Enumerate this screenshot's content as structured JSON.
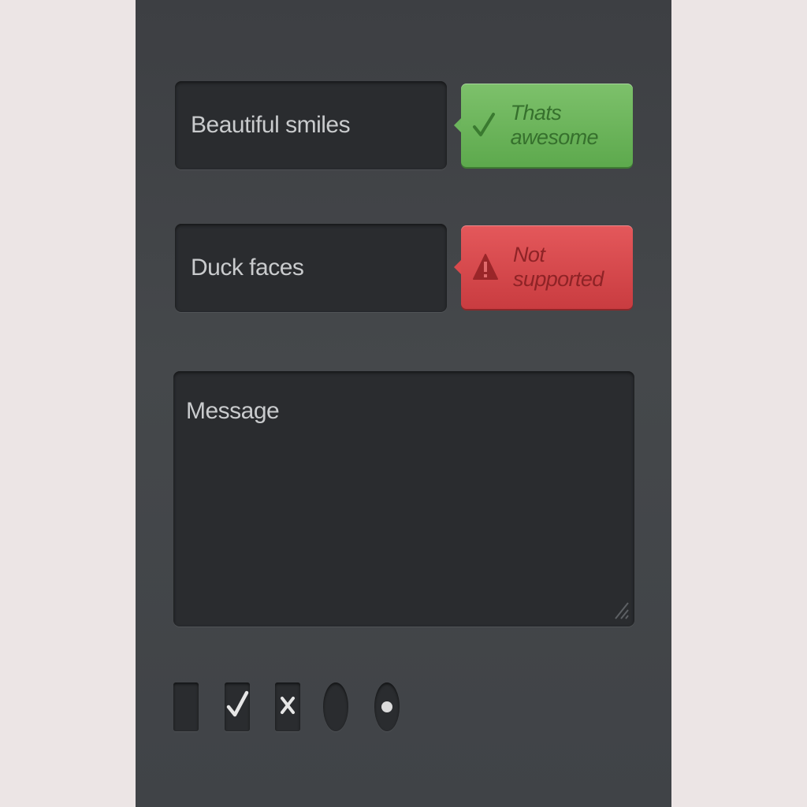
{
  "form": {
    "field_1": {
      "value": "Beautiful smiles"
    },
    "field_2": {
      "value": "Duck faces"
    },
    "message": {
      "placeholder": "Message"
    }
  },
  "tooltips": {
    "success": {
      "label": "Thats awesome",
      "icon": "check-icon",
      "color": "#6cb45c"
    },
    "error": {
      "label": "Not supported",
      "icon": "warning-icon",
      "color": "#d84a4d"
    }
  },
  "controls": {
    "checkbox_unchecked": {
      "checked": false
    },
    "checkbox_checked": {
      "checked": true,
      "icon": "check-icon"
    },
    "checkbox_crossed": {
      "checked": true,
      "icon": "x-icon"
    },
    "radio_unselected": {
      "selected": false
    },
    "radio_selected": {
      "selected": true
    }
  },
  "colors": {
    "page_bg": "#ece5e5",
    "panel_bg": "#404347",
    "field_bg": "#2a2c2f",
    "text": "#c9cbcd"
  }
}
